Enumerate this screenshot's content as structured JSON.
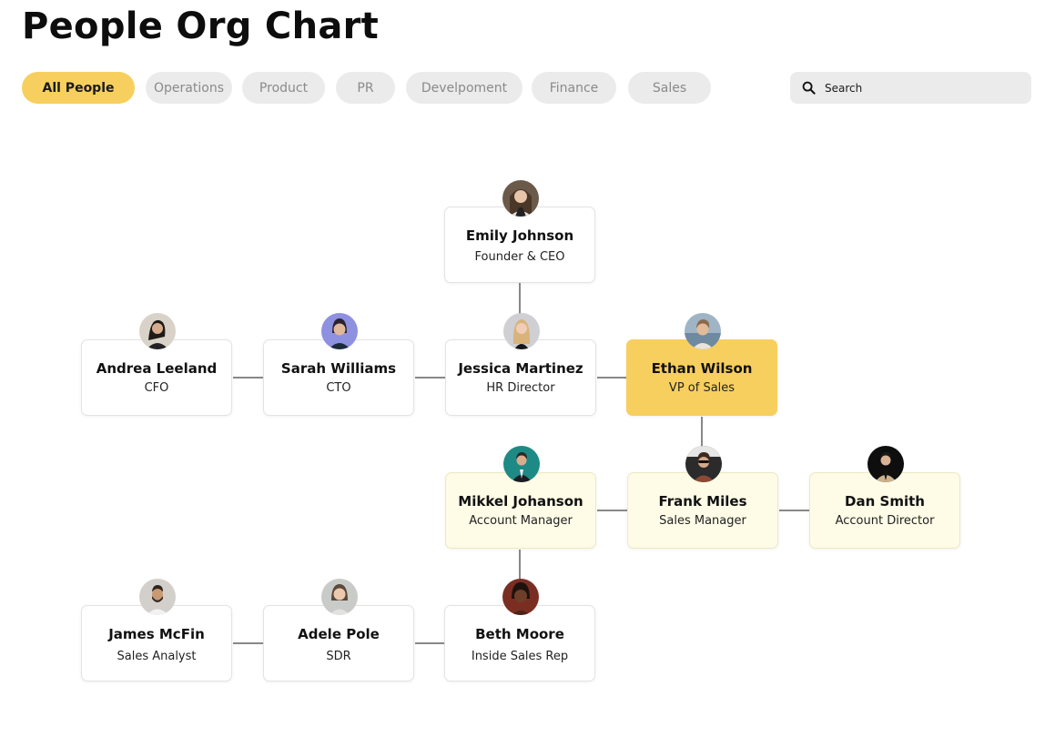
{
  "header": {
    "title": "People Org Chart"
  },
  "filters": [
    {
      "label": "All People",
      "active": true
    },
    {
      "label": "Operations",
      "active": false
    },
    {
      "label": "Product",
      "active": false
    },
    {
      "label": "PR",
      "active": false
    },
    {
      "label": "Develpoment",
      "active": false
    },
    {
      "label": "Finance",
      "active": false
    },
    {
      "label": "Sales",
      "active": false
    }
  ],
  "search": {
    "placeholder": "Search",
    "value": ""
  },
  "colors": {
    "accent": "#f7cf5e",
    "light_highlight": "#fefbe6",
    "tab_inactive": "#ebebeb"
  },
  "people": {
    "emily": {
      "name": "Emily Johnson",
      "role": "Founder & CEO",
      "avatar_icon": "avatar-photo"
    },
    "andrea": {
      "name": "Andrea Leeland",
      "role": "CFO",
      "avatar_icon": "avatar-photo"
    },
    "sarah": {
      "name": "Sarah Williams",
      "role": "CTO",
      "avatar_icon": "avatar-photo"
    },
    "jessica": {
      "name": "Jessica Martinez",
      "role": "HR Director",
      "avatar_icon": "avatar-photo"
    },
    "ethan": {
      "name": "Ethan Wilson",
      "role": "VP of Sales",
      "avatar_icon": "avatar-photo",
      "selected": true
    },
    "mikkel": {
      "name": "Mikkel Johanson",
      "role": "Account Manager",
      "avatar_icon": "avatar-photo"
    },
    "frank": {
      "name": "Frank Miles",
      "role": "Sales Manager",
      "avatar_icon": "avatar-photo"
    },
    "dan": {
      "name": "Dan Smith",
      "role": "Account Director",
      "avatar_icon": "avatar-photo"
    },
    "james": {
      "name": "James McFin",
      "role": "Sales Analyst",
      "avatar_icon": "avatar-photo"
    },
    "adele": {
      "name": "Adele Pole",
      "role": "SDR",
      "avatar_icon": "avatar-photo"
    },
    "beth": {
      "name": "Beth Moore",
      "role": "Inside Sales Rep",
      "avatar_icon": "avatar-photo"
    }
  }
}
